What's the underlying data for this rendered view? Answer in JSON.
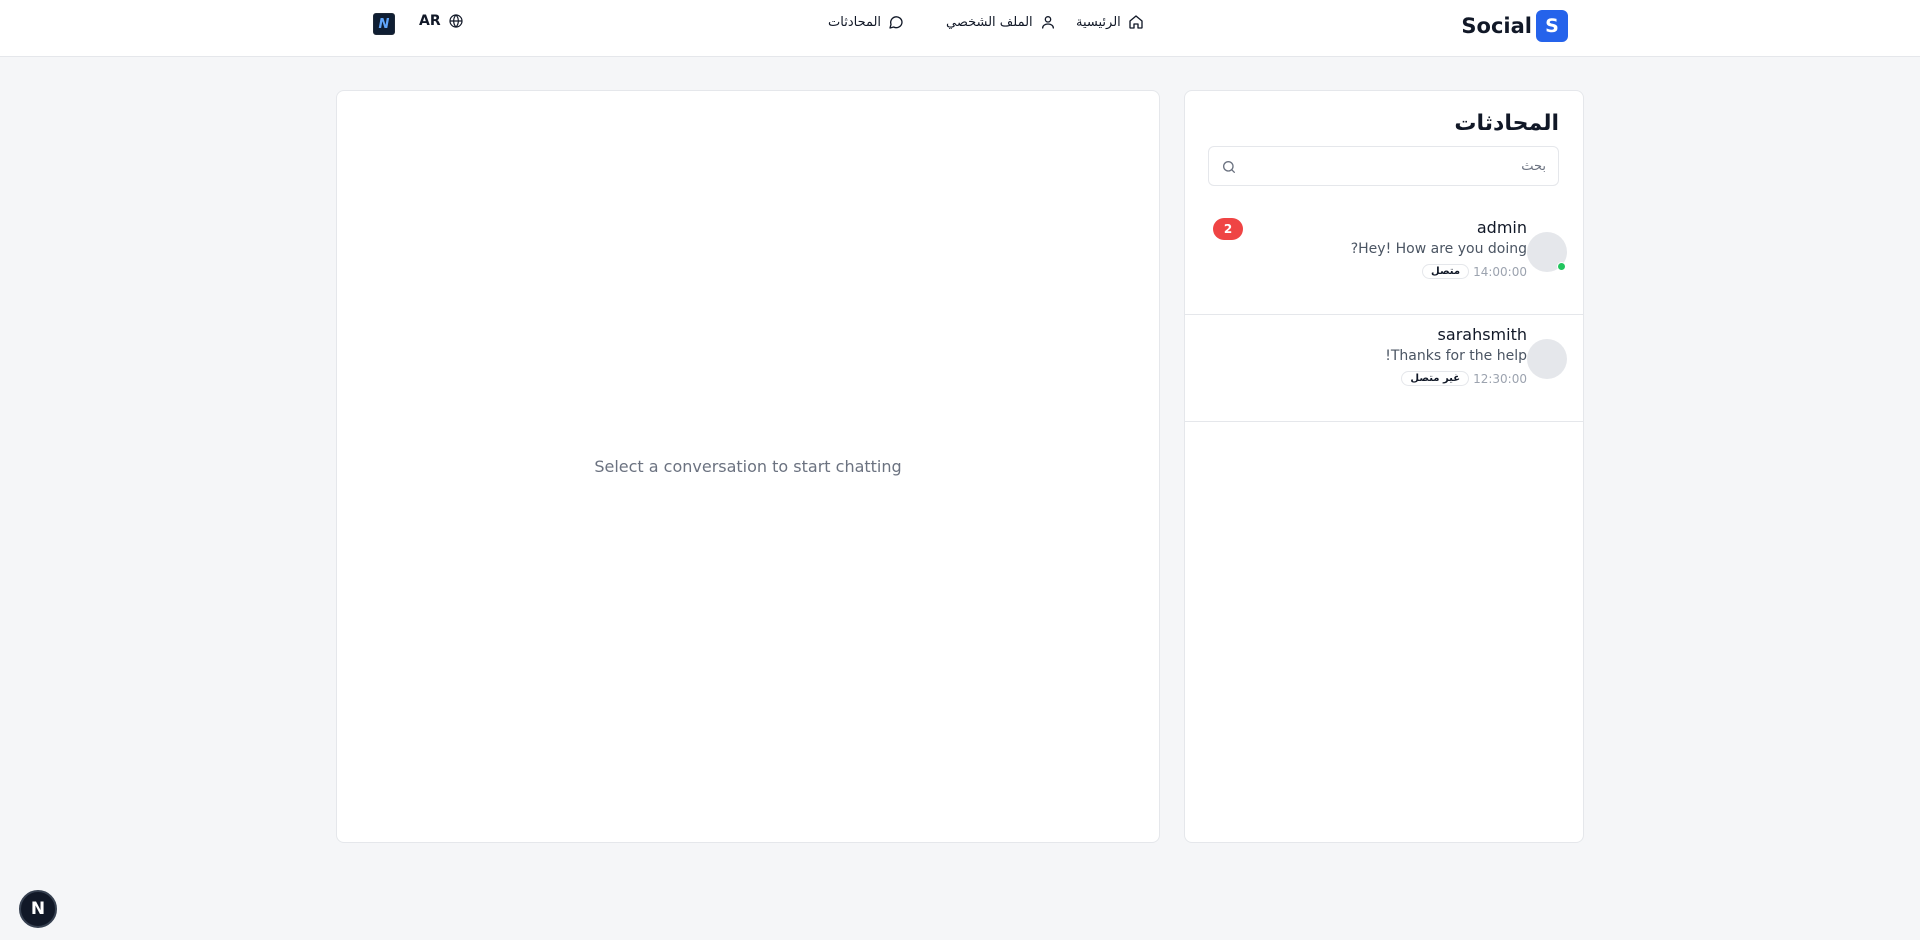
{
  "header": {
    "brand_logo": "S",
    "brand_name": "Social",
    "nav": {
      "home": "الرئيسية",
      "profile": "الملف الشخصي",
      "chats": "المحادثات"
    },
    "language": "AR",
    "extension_icon": "N"
  },
  "chat": {
    "empty_text": "Select a conversation to start chatting"
  },
  "conversations": {
    "title": "المحادثات",
    "search_placeholder": "بحث",
    "items": [
      {
        "name": "admin",
        "message": "Hey! How are you doing?",
        "time": "14:00:00",
        "status": "متصل",
        "online": true,
        "unread": "2"
      },
      {
        "name": "sarahsmith",
        "message": "Thanks for the help!",
        "time": "12:30:00",
        "status": "غير متصل",
        "online": false,
        "unread": ""
      }
    ]
  },
  "floating_button": "N",
  "colors": {
    "brand": "#2563eb",
    "online": "#22c55e",
    "badge": "#ef4444",
    "background": "#f5f6f8"
  }
}
